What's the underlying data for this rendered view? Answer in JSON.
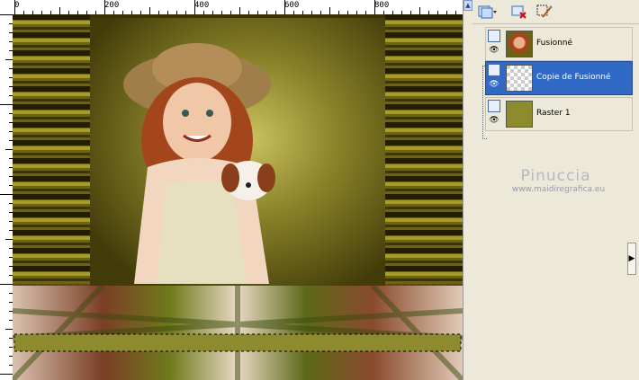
{
  "ruler": {
    "labels": [
      "0",
      "200",
      "400",
      "600",
      "800"
    ]
  },
  "canvas": {
    "description_hidden": ""
  },
  "layers_palette": {
    "toolbar_icons": [
      "new-layer-icon",
      "delete-layer-icon",
      "mask-icon"
    ],
    "layers": [
      {
        "name": "Fusionné",
        "selected": false
      },
      {
        "name": "Copie de Fusionné",
        "selected": true
      },
      {
        "name": "Raster 1",
        "selected": false
      }
    ]
  },
  "watermark": {
    "name": "Pinuccia",
    "url": "www.maidiregrafica.eu"
  },
  "colors": {
    "selection": "#316ac5",
    "raster_fill": "#8e8a2e",
    "panel_bg": "#ece9d8"
  }
}
